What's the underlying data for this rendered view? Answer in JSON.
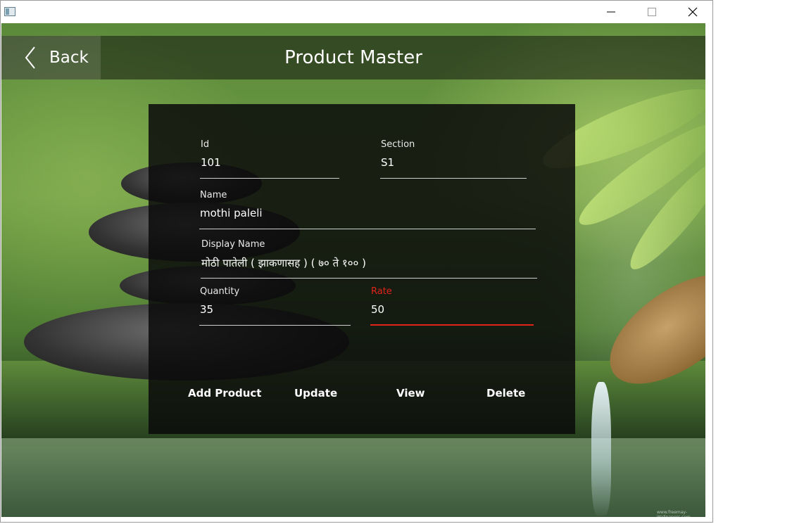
{
  "window": {
    "controls": {
      "minimize": "minimize",
      "maximize": "maximize",
      "close": "close"
    }
  },
  "header": {
    "back_label": "Back",
    "title": "Product Master"
  },
  "form": {
    "id": {
      "label": "Id",
      "value": "101"
    },
    "section": {
      "label": "Section",
      "value": "S1"
    },
    "name": {
      "label": "Name",
      "value": "mothi paleli"
    },
    "display_name": {
      "label": "Display Name",
      "value": "मोठी पातेली ( झाकणासह ) ( ७० ते १०० )"
    },
    "quantity": {
      "label": "Quantity",
      "value": "35"
    },
    "rate": {
      "label": "Rate",
      "value": "50",
      "accent": "#e0241a"
    }
  },
  "actions": {
    "add": "Add Product",
    "update": "Update",
    "view": "View",
    "delete": "Delete"
  },
  "footer": {
    "watermark": "www.freemay-Wallpapers.com"
  }
}
